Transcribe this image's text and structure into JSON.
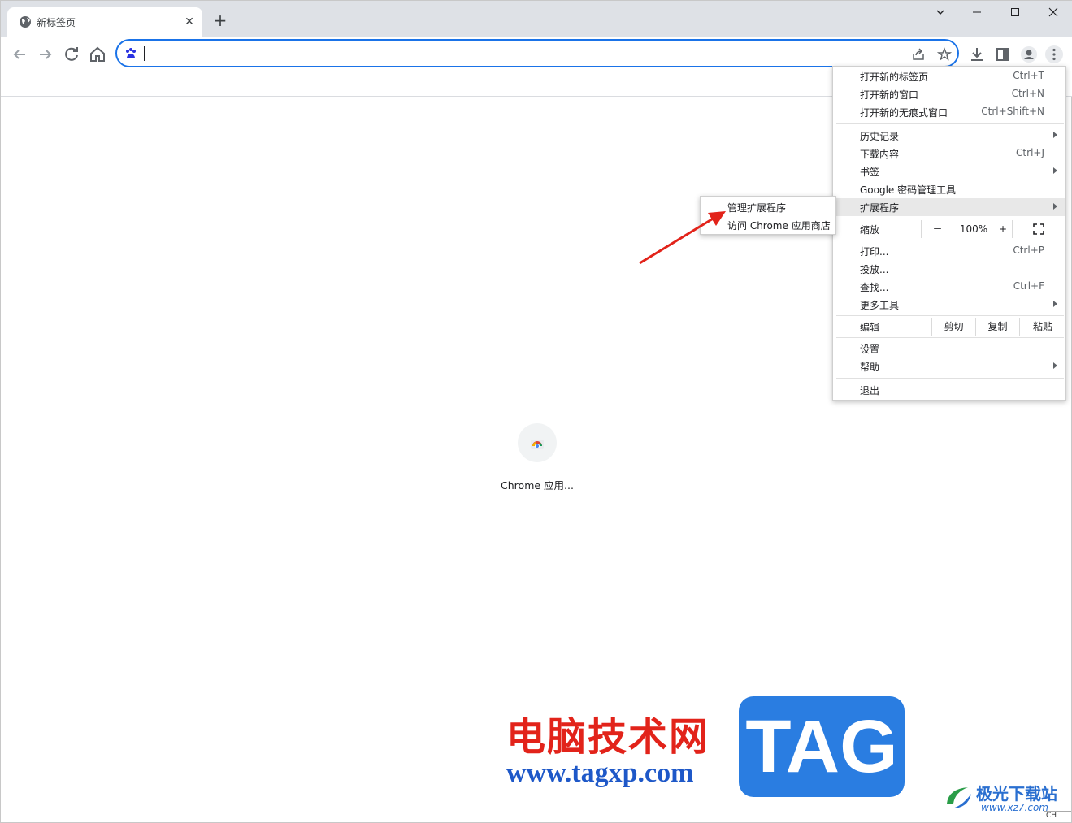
{
  "tab": {
    "title": "新标签页",
    "favicon": "globe-icon",
    "close": "✕"
  },
  "window": {
    "new_tab": "+",
    "minimize": "—",
    "maximize": "☐",
    "close": "✕",
    "dropdown": "⌄"
  },
  "toolbar": {
    "back": "back-arrow-icon",
    "forward": "forward-arrow-icon",
    "reload": "reload-icon",
    "home": "home-icon",
    "omnibox_value": "",
    "search_engine_icon": "baidu-paw-icon"
  },
  "shortcut": {
    "label": "Chrome 应用..."
  },
  "menu": {
    "new_tab": {
      "label": "打开新的标签页",
      "shortcut": "Ctrl+T"
    },
    "new_window": {
      "label": "打开新的窗口",
      "shortcut": "Ctrl+N"
    },
    "incognito": {
      "label": "打开新的无痕式窗口",
      "shortcut": "Ctrl+Shift+N"
    },
    "history": {
      "label": "历史记录"
    },
    "downloads": {
      "label": "下载内容",
      "shortcut": "Ctrl+J"
    },
    "bookmarks": {
      "label": "书签"
    },
    "passwords": {
      "label": "Google 密码管理工具"
    },
    "extensions": {
      "label": "扩展程序"
    },
    "zoom": {
      "label": "缩放",
      "minus": "－",
      "value": "100%",
      "plus": "+"
    },
    "print": {
      "label": "打印...",
      "shortcut": "Ctrl+P"
    },
    "cast": {
      "label": "投放..."
    },
    "find": {
      "label": "查找...",
      "shortcut": "Ctrl+F"
    },
    "more_tools": {
      "label": "更多工具"
    },
    "edit": {
      "label": "编辑",
      "cut": "剪切",
      "copy": "复制",
      "paste": "粘贴"
    },
    "settings": {
      "label": "设置"
    },
    "help": {
      "label": "帮助"
    },
    "exit": {
      "label": "退出"
    }
  },
  "submenu": {
    "manage": "管理扩展程序",
    "store": "访问 Chrome 应用商店"
  },
  "watermark": {
    "cn": "电脑技术网",
    "url": "www.tagxp.com",
    "tag": "TAG",
    "jg_cn": "极光下载站",
    "jg_url": "www.xz7.com"
  },
  "ime": "CH",
  "colors": {
    "accent": "#1a73e8",
    "annotation_arrow": "#e2231a"
  }
}
